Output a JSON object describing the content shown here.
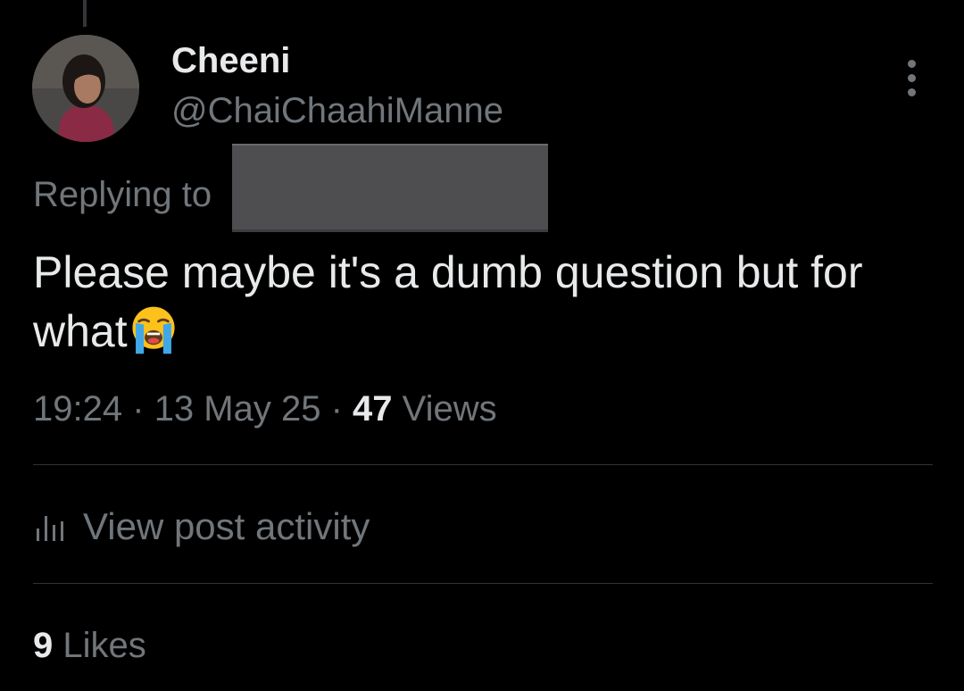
{
  "user": {
    "display_name": "Cheeni",
    "handle": "@ChaiChaahiManne"
  },
  "reply": {
    "label": "Replying to"
  },
  "tweet": {
    "text": "Please maybe it's a dumb question but for what",
    "emoji": "loudly-crying-face"
  },
  "meta": {
    "time": "19:24",
    "separator": "·",
    "date": "13 May 25",
    "views_count": "47",
    "views_label": "Views"
  },
  "activity": {
    "label": "View post activity",
    "icon": "bar-chart-icon"
  },
  "likes": {
    "count": "9",
    "label": "Likes"
  },
  "colors": {
    "background": "#000000",
    "primary_text": "#e7e9ea",
    "secondary_text": "#71767b",
    "divider": "#2f3336"
  }
}
